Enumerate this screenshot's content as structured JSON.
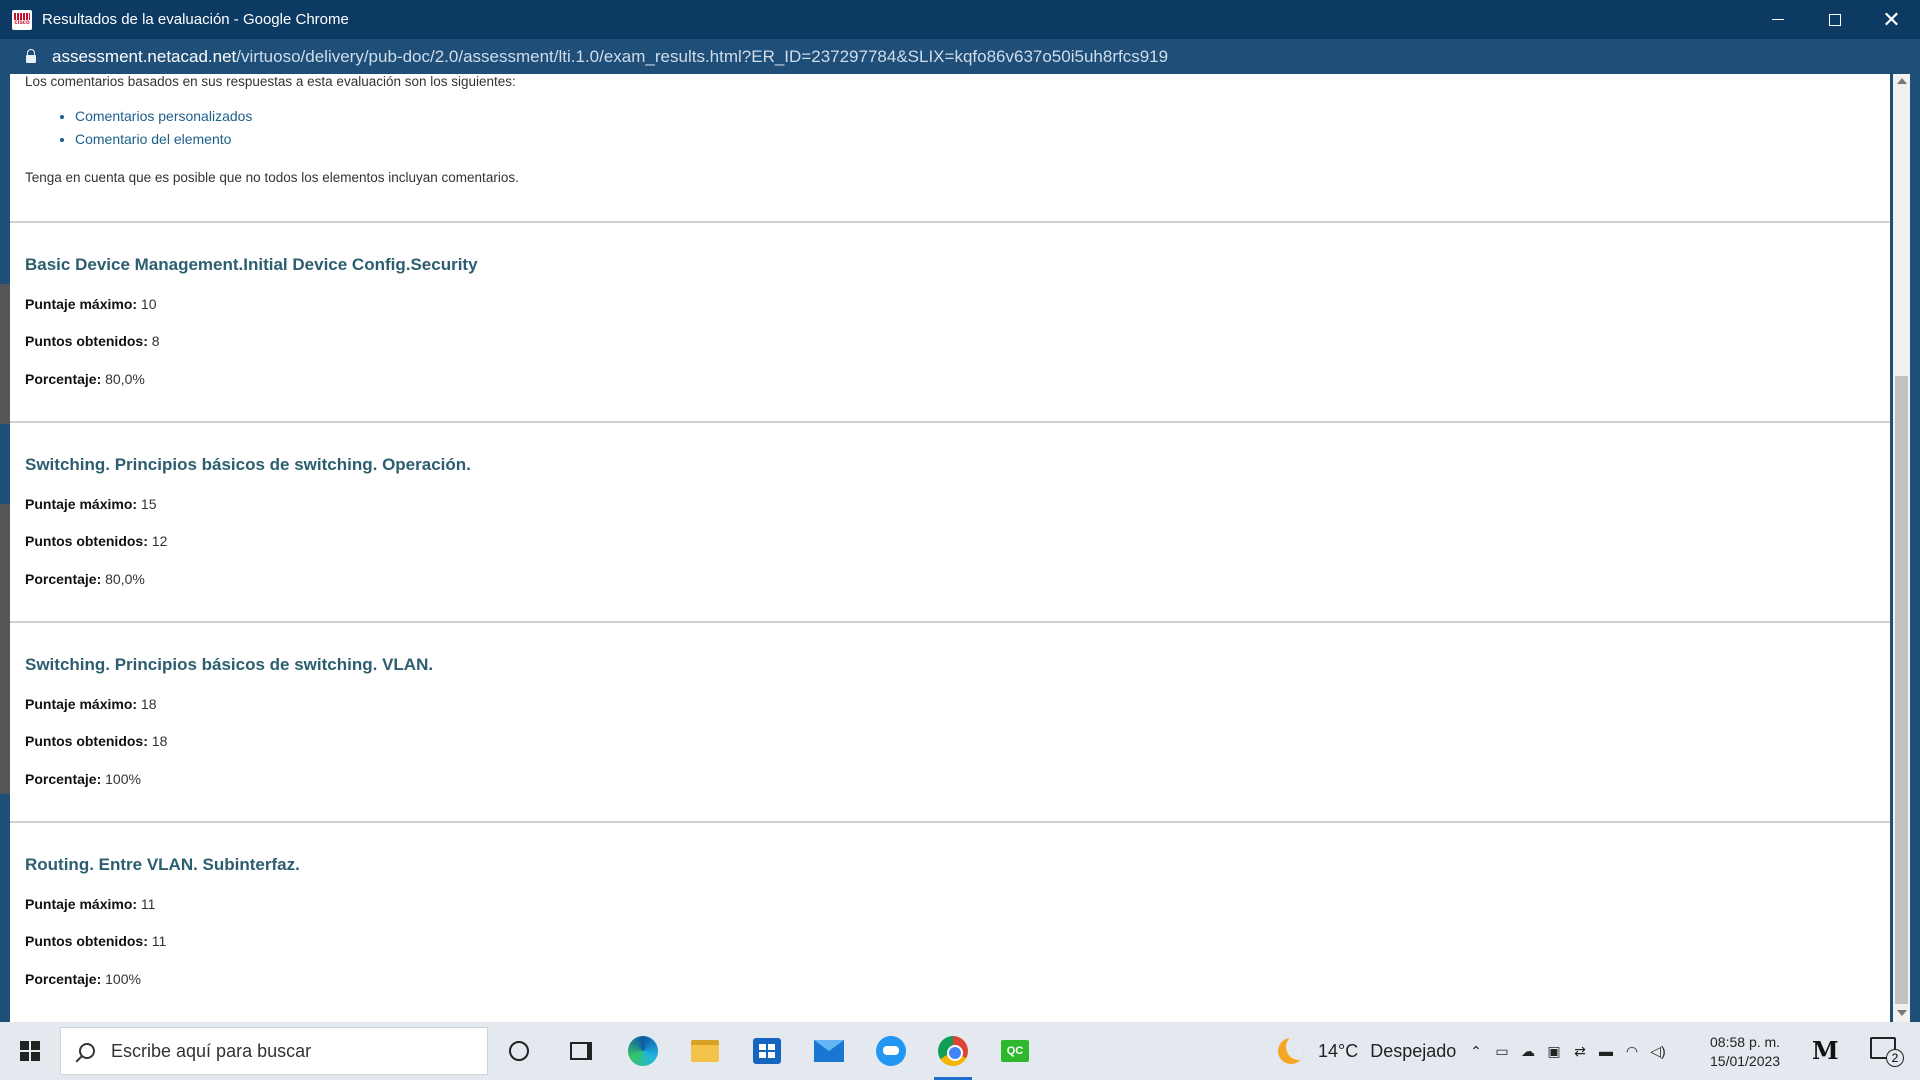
{
  "window": {
    "title": "Resultados de la evaluación - Google Chrome",
    "app_icon_label": "cisco"
  },
  "address": {
    "host": "assessment.netacad.net",
    "path": "/virtuoso/delivery/pub-doc/2.0/assessment/lti.1.0/exam_results.html?ER_ID=237297784&SLIX=kqfo86v637o50i5uh8rfcs919"
  },
  "content": {
    "intro": "Los comentarios basados en sus respuestas a esta evaluación son los siguientes:",
    "links": [
      "Comentarios personalizados",
      "Comentario del elemento"
    ],
    "note": "Tenga en cuenta que es posible que no todos los elementos incluyan comentarios."
  },
  "labels": {
    "max": "Puntaje máximo:",
    "earned": "Puntos obtenidos:",
    "pct": "Porcentaje:"
  },
  "sections": [
    {
      "title": "Basic Device Management.Initial Device Config.Security",
      "max": "10",
      "earned": "8",
      "pct": "80,0%"
    },
    {
      "title": "Switching. Principios básicos de switching. Operación.",
      "max": "15",
      "earned": "12",
      "pct": "80,0%"
    },
    {
      "title": "Switching. Principios básicos de switching. VLAN.",
      "max": "18",
      "earned": "18",
      "pct": "100%"
    },
    {
      "title": "Routing. Entre VLAN. Subinterfaz.",
      "max": "11",
      "earned": "11",
      "pct": "100%"
    }
  ],
  "taskbar": {
    "search_placeholder": "Escribe aquí para buscar",
    "qc_label": "QC",
    "temperature": "14°C",
    "weather": "Despejado",
    "time": "08:58 p. m.",
    "date": "15/01/2023",
    "notification_count": "2",
    "tray_icons": [
      "chevron-up-icon",
      "meet-now-icon",
      "onedrive-icon",
      "windows-security-icon",
      "network-icon",
      "battery-icon",
      "wifi-icon",
      "volume-icon"
    ]
  }
}
